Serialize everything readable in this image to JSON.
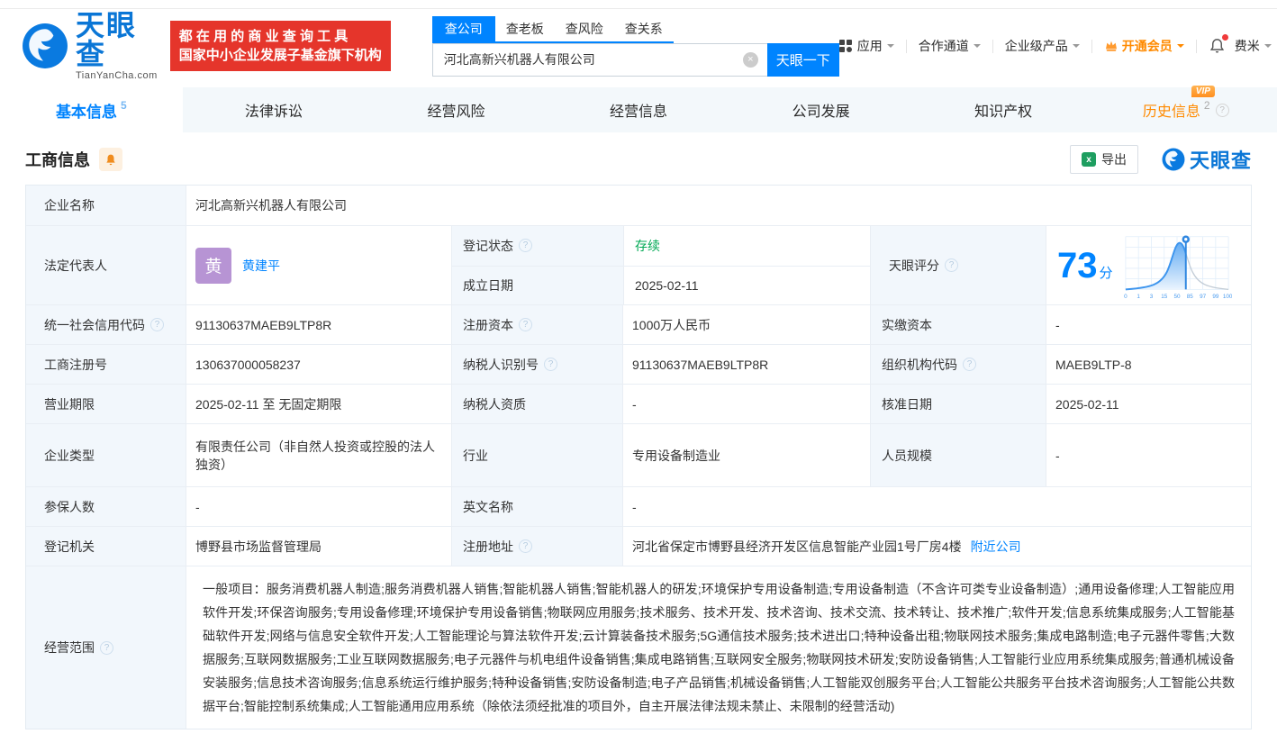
{
  "header": {
    "logo": {
      "brand": "天眼查",
      "domain": "TianYanCha.com"
    },
    "slogan": {
      "line1": "都 在 用 的 商 业 查 询 工 具",
      "line2": "国家中小企业发展子基金旗下机构"
    },
    "search": {
      "tabs": [
        {
          "label": "查公司"
        },
        {
          "label": "查老板"
        },
        {
          "label": "查风险"
        },
        {
          "label": "查关系"
        }
      ],
      "value": "河北高新兴机器人有限公司",
      "button": "天眼一下"
    },
    "nav": {
      "apps": "应用",
      "partner": "合作通道",
      "enterprise": "企业级产品",
      "membership": "开通会员",
      "user": "费米"
    }
  },
  "tabs": [
    {
      "label": "基本信息",
      "count": "5"
    },
    {
      "label": "法律诉讼"
    },
    {
      "label": "经营风险"
    },
    {
      "label": "经营信息"
    },
    {
      "label": "公司发展"
    },
    {
      "label": "知识产权"
    },
    {
      "label": "历史信息",
      "count": "2",
      "vip_label": "VIP"
    }
  ],
  "section": {
    "title": "工商信息",
    "export_label": "导出",
    "watermark_brand": "天眼查"
  },
  "table": {
    "company_name": {
      "label": "企业名称",
      "value": "河北高新兴机器人有限公司"
    },
    "legal_rep": {
      "label": "法定代表人",
      "avatar": "黄",
      "name": "黄建平"
    },
    "reg_status": {
      "label": "登记状态",
      "value": "存续"
    },
    "establish_date": {
      "label": "成立日期",
      "value": "2025-02-11"
    },
    "score": {
      "label": "天眼评分"
    },
    "credit_code": {
      "label": "统一社会信用代码",
      "value": "91130637MAEB9LTP8R"
    },
    "reg_capital": {
      "label": "注册资本",
      "value": "1000万人民币"
    },
    "paid_capital": {
      "label": "实缴资本",
      "value": "-"
    },
    "reg_number": {
      "label": "工商注册号",
      "value": "130637000058237"
    },
    "taxpayer_id": {
      "label": "纳税人识别号",
      "value": "91130637MAEB9LTP8R"
    },
    "org_code": {
      "label": "组织机构代码",
      "value": "MAEB9LTP-8"
    },
    "business_term": {
      "label": "营业期限",
      "value": "2025-02-11 至 无固定期限"
    },
    "taxpayer_qualification": {
      "label": "纳税人资质",
      "value": "-"
    },
    "approval_date": {
      "label": "核准日期",
      "value": "2025-02-11"
    },
    "company_type": {
      "label": "企业类型",
      "value": "有限责任公司（非自然人投资或控股的法人独资）"
    },
    "industry": {
      "label": "行业",
      "value": "专用设备制造业"
    },
    "staff_size": {
      "label": "人员规模",
      "value": "-"
    },
    "insured_count": {
      "label": "参保人数",
      "value": "-"
    },
    "english_name": {
      "label": "英文名称",
      "value": "-"
    },
    "registry": {
      "label": "登记机关",
      "value": "博野县市场监督管理局"
    },
    "reg_address": {
      "label": "注册地址",
      "value": "河北省保定市博野县经济开发区信息智能产业园1号厂房4楼",
      "link": "附近公司"
    },
    "business_scope": {
      "label": "经营范围",
      "value": "一般项目：服务消费机器人制造;服务消费机器人销售;智能机器人销售;智能机器人的研发;环境保护专用设备制造;专用设备制造（不含许可类专业设备制造）;通用设备修理;人工智能应用软件开发;环保咨询服务;专用设备修理;环境保护专用设备销售;物联网应用服务;技术服务、技术开发、技术咨询、技术交流、技术转让、技术推广;软件开发;信息系统集成服务;人工智能基础软件开发;网络与信息安全软件开发;人工智能理论与算法软件开发;云计算装备技术服务;5G通信技术服务;技术进出口;特种设备出租;物联网技术服务;集成电路制造;电子元器件零售;大数据服务;互联网数据服务;工业互联网数据服务;电子元器件与机电组件设备销售;集成电路销售;互联网安全服务;物联网技术研发;安防设备销售;人工智能行业应用系统集成服务;普通机械设备安装服务;信息技术咨询服务;信息系统运行维护服务;特种设备销售;安防设备制造;电子产品销售;机械设备销售;人工智能双创服务平台;人工智能公共服务平台技术咨询服务;人工智能公共数据平台;智能控制系统集成;人工智能通用应用系统（除依法须经批准的项目外，自主开展法律法规未禁止、未限制的经营活动)"
    }
  },
  "score_chart": {
    "score": "73",
    "unit": "分",
    "marker_value": 73,
    "ticks": [
      "0",
      "1",
      "3",
      "15",
      "50",
      "85",
      "97",
      "99",
      "100"
    ]
  },
  "colors": {
    "brand_blue": "#0084ff",
    "vip_orange": "#ff8a00",
    "status_green": "#00a854",
    "banner_red": "#e5352b"
  }
}
